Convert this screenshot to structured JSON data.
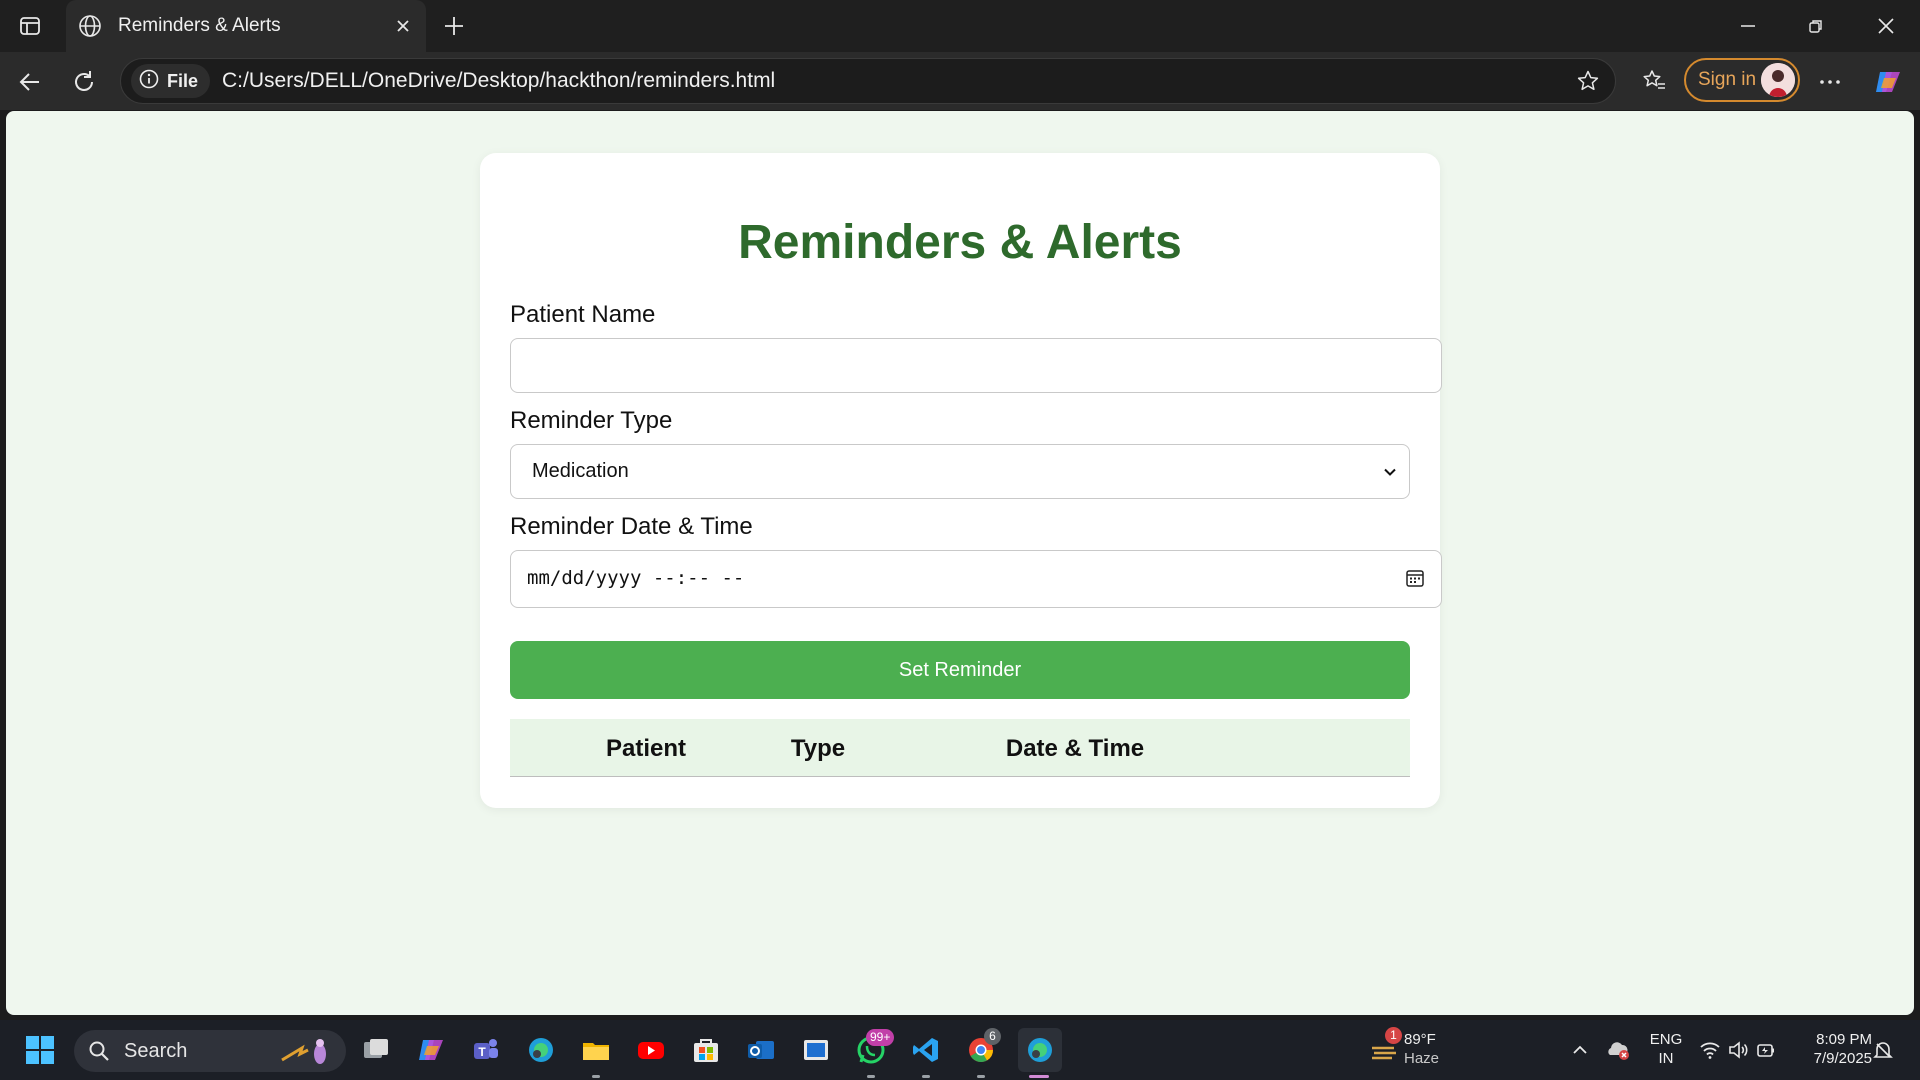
{
  "browser": {
    "tab_title": "Reminders & Alerts",
    "file_chip": "File",
    "url": "C:/Users/DELL/OneDrive/Desktop/hackthon/reminders.html",
    "sign_in_label": "Sign in"
  },
  "form": {
    "heading": "Reminders & Alerts",
    "patient_name_label": "Patient Name",
    "patient_name_value": "",
    "reminder_type_label": "Reminder Type",
    "reminder_type_value": "Medication",
    "datetime_label": "Reminder Date & Time",
    "datetime_placeholder": "mm/dd/yyyy --:-- --",
    "submit_label": "Set Reminder"
  },
  "table": {
    "columns": [
      "Patient",
      "Type",
      "Date & Time"
    ],
    "rows": []
  },
  "taskbar": {
    "search_label": "Search",
    "weather_temp": "89°F",
    "weather_desc": "Haze",
    "weather_badge": "1",
    "whatsapp_badge": "99+",
    "chrome_badge": "6",
    "lang_top": "ENG",
    "lang_bottom": "IN",
    "time": "8:09 PM",
    "date": "7/9/2025"
  },
  "colors": {
    "page_background": "#eff7ee",
    "heading_green": "#2e6a2c",
    "button_green": "#4caf50",
    "table_header_bg": "#e8f5e7",
    "signin_accent": "#d58a2e"
  }
}
